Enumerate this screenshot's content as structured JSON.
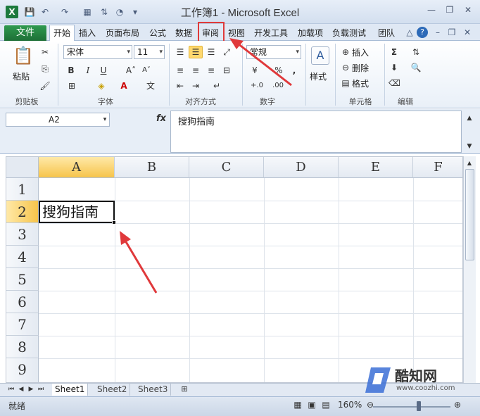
{
  "window": {
    "title": "工作簿1 - Microsoft Excel",
    "app_icon": "X"
  },
  "ribbon_tabs": {
    "file": "文件",
    "home": "开始",
    "insert": "插入",
    "page_layout": "页面布局",
    "formulas": "公式",
    "data": "数据",
    "review": "审阅",
    "view": "视图",
    "developer": "开发工具",
    "addins": "加载项",
    "load_test": "负载测试",
    "team": "团队"
  },
  "ribbon": {
    "paste_label": "粘贴",
    "clipboard_group": "剪贴板",
    "font_name": "宋体",
    "font_size": "11",
    "font_group": "字体",
    "alignment_group": "对齐方式",
    "number_format": "常规",
    "number_group": "数字",
    "style_label": "样式",
    "insert_label": "插入",
    "delete_label": "删除",
    "format_label": "格式",
    "cells_group": "单元格",
    "editing_group": "编辑",
    "percent": "%",
    "comma": ","
  },
  "formula_bar": {
    "name_box": "A2",
    "fx": "fx",
    "content": "搜狗指南"
  },
  "grid": {
    "columns": [
      "A",
      "B",
      "C",
      "D",
      "E",
      "F"
    ],
    "rows": [
      "1",
      "2",
      "3",
      "4",
      "5",
      "6",
      "7",
      "8",
      "9"
    ],
    "cell_a2": "搜狗指南"
  },
  "sheets": {
    "tabs": [
      "Sheet1",
      "Sheet2",
      "Sheet3"
    ]
  },
  "status": {
    "ready": "就绪",
    "zoom": "160%"
  },
  "watermark": {
    "name": "酷知网",
    "url": "www.coozhi.com"
  },
  "colors": {
    "accent_green": "#1e6f37",
    "highlight_red": "#e03a3a",
    "selection_yellow": "#f6c44b"
  }
}
